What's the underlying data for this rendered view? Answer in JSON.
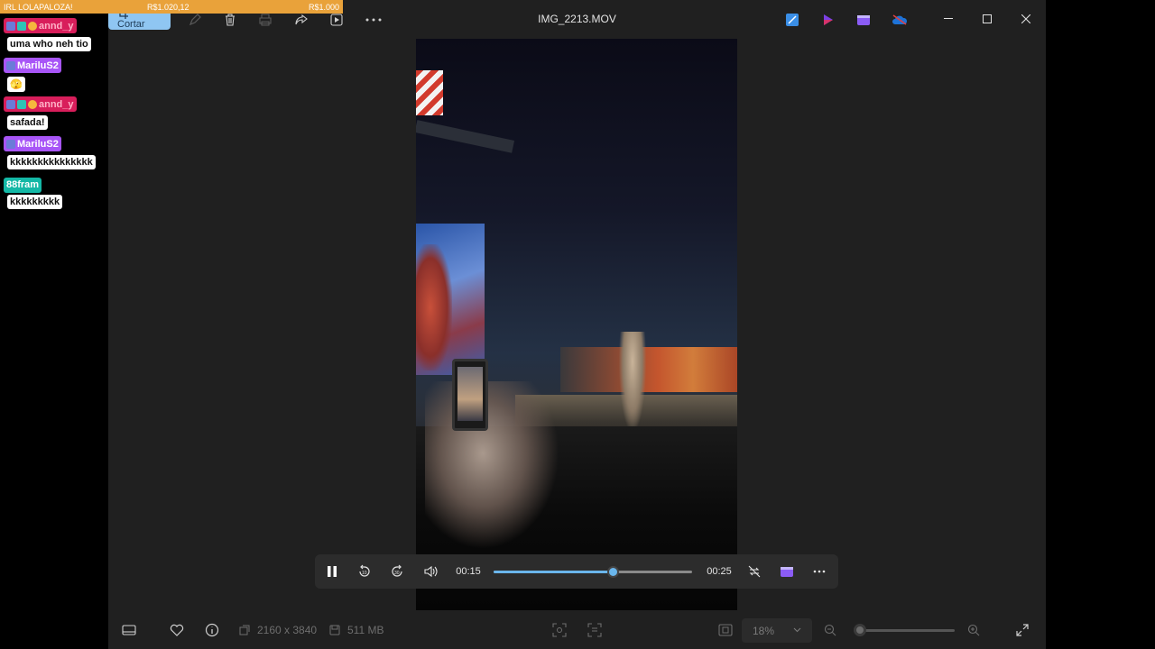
{
  "chat": {
    "goal": {
      "title": "IRL LOLAPALOZA!",
      "current": "R$1.020,12",
      "target": "R$1.000"
    },
    "messages": [
      {
        "user": "annd_y",
        "text": "uma who neh tio",
        "color": "#d81e5b"
      },
      {
        "user": "MariluS2",
        "text": "🫣",
        "color": "#a855f7"
      },
      {
        "user": "annd_y",
        "text": "safada!",
        "color": "#d81e5b"
      },
      {
        "user": "MariluS2",
        "text": "kkkkkkkkkkkkkkk",
        "color": "#a855f7"
      },
      {
        "user": "88fram",
        "text": "kkkkkkkkk",
        "color": "#14b8a6"
      }
    ]
  },
  "toolbar": {
    "crop_label": "Cortar",
    "icons": [
      "crop-icon",
      "edit-icon",
      "delete-icon",
      "print-icon",
      "share-icon",
      "slideshow-icon",
      "more-icon"
    ]
  },
  "window": {
    "title": "IMG_2213.MOV",
    "taskbar_icons": [
      "photo-editor-icon",
      "clipchamp-icon",
      "video-editor-icon",
      "onedrive-icon"
    ],
    "controls": [
      "minimize-icon",
      "maximize-icon",
      "close-icon"
    ]
  },
  "player": {
    "current_time": "00:15",
    "total_time": "00:25",
    "progress": 0.6,
    "state": "playing"
  },
  "bottom": {
    "resolution": "2160 x 3840",
    "file_size": "511 MB",
    "zoom": "18%",
    "zoom_level": 0.0
  }
}
